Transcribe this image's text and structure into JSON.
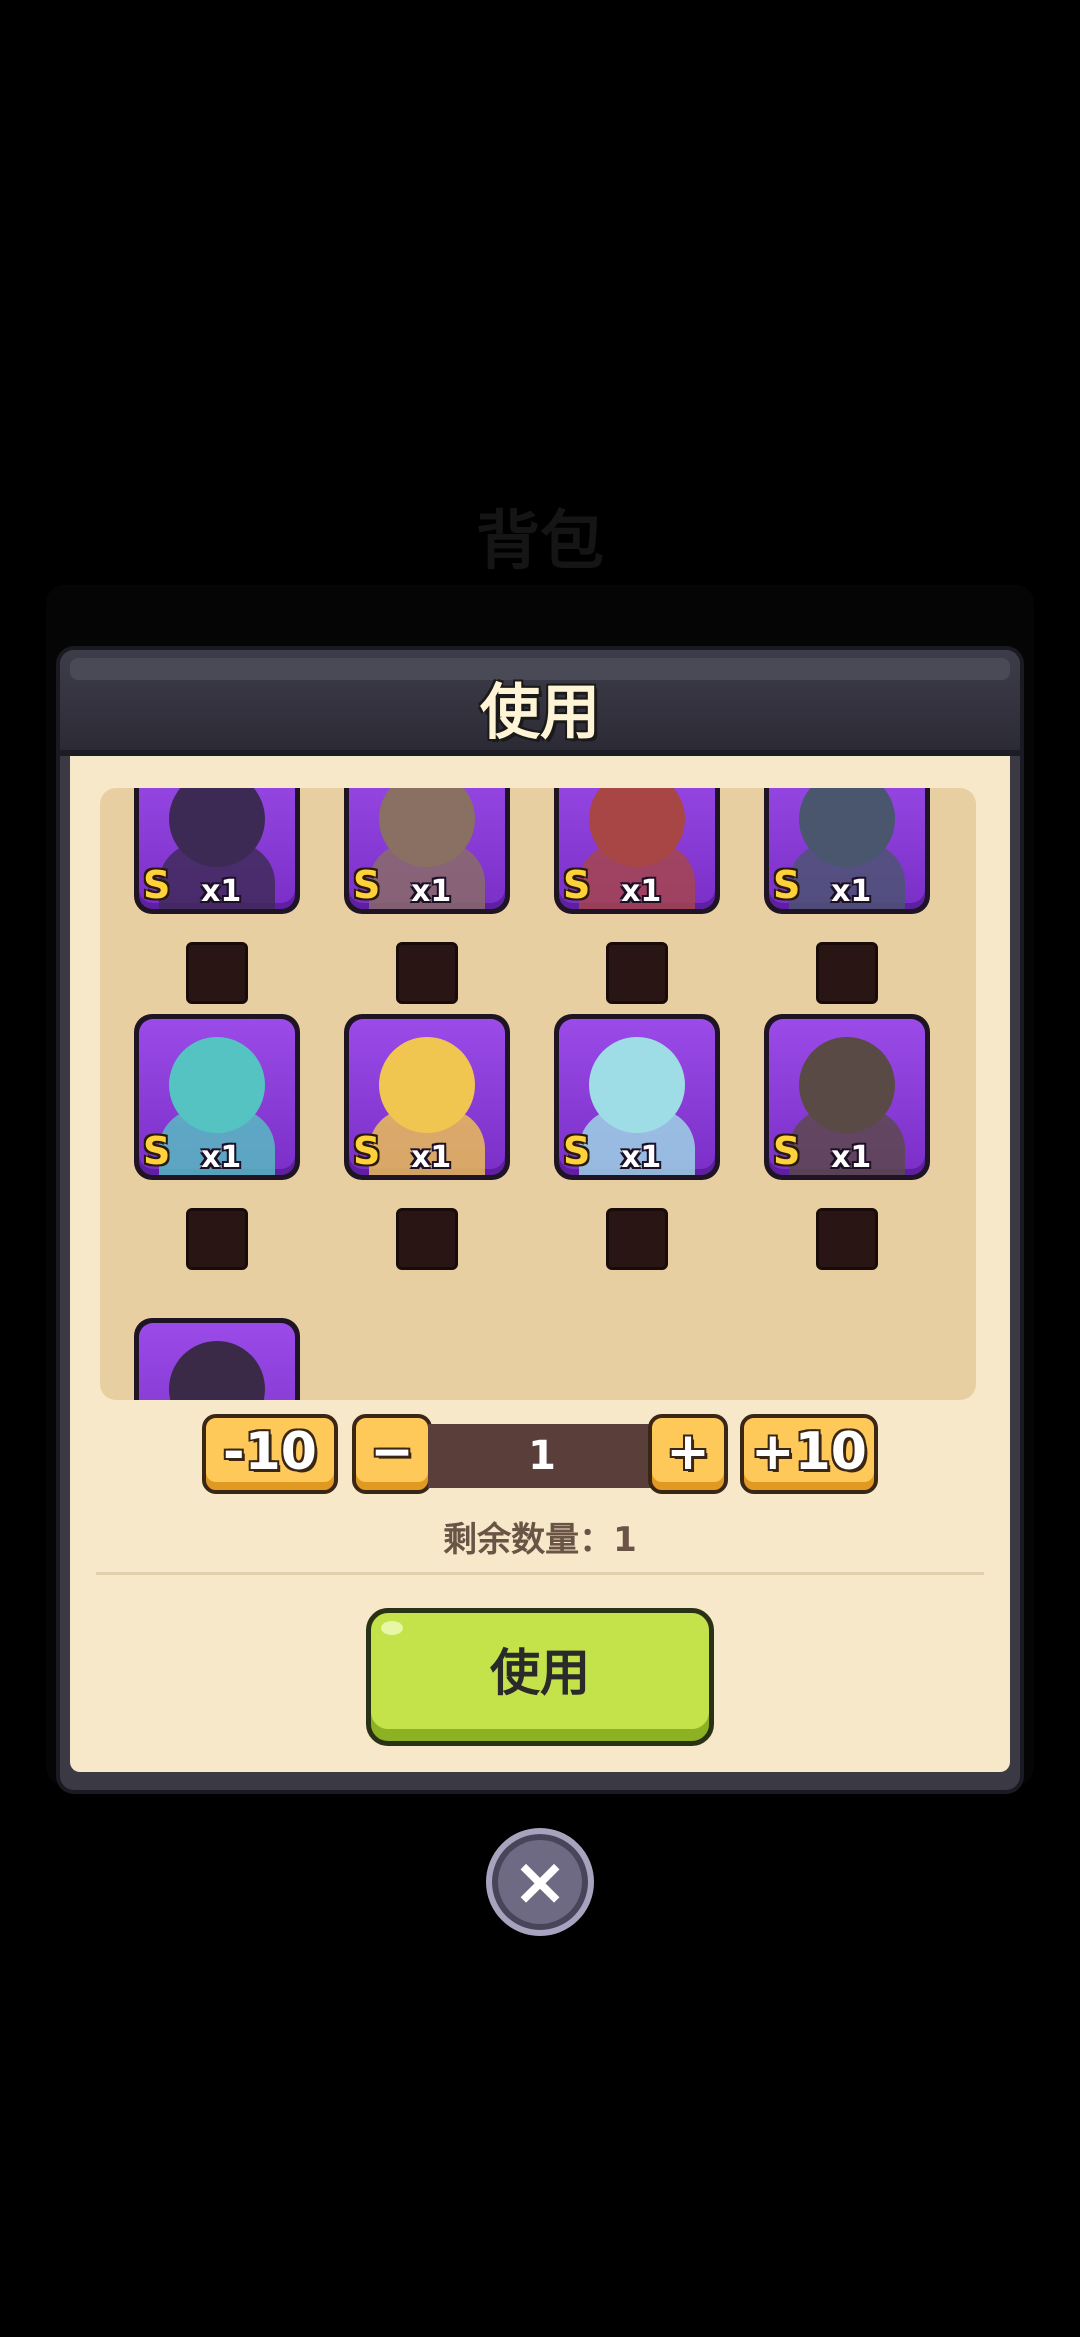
{
  "background_title": "背包",
  "modal": {
    "title": "使用"
  },
  "items": [
    {
      "rank": "S",
      "count": "x1",
      "color": "#3c2a54",
      "name": "shadow-flower"
    },
    {
      "rank": "S",
      "count": "x1",
      "color": "#8a6f63",
      "name": "knight"
    },
    {
      "rank": "S",
      "count": "x1",
      "color": "#a84646",
      "name": "red-beast"
    },
    {
      "rank": "S",
      "count": "x1",
      "color": "#4a566e",
      "name": "robot"
    },
    {
      "rank": "S",
      "count": "x1",
      "color": "#55c3c1",
      "name": "hooded-ghost"
    },
    {
      "rank": "S",
      "count": "x1",
      "color": "#f0c650",
      "name": "pharaoh"
    },
    {
      "rank": "S",
      "count": "x1",
      "color": "#9fdde6",
      "name": "ice-warrior"
    },
    {
      "rank": "S",
      "count": "x1",
      "color": "#5a4a45",
      "name": "stone-golem"
    },
    {
      "rank": "",
      "count": "",
      "color": "#3a2a48",
      "name": "dark-hero"
    }
  ],
  "stepper": {
    "minus10": "-10",
    "minus": "−",
    "value": "1",
    "plus": "+",
    "plus10": "+10"
  },
  "remaining_label": "剩余数量：1",
  "use_button": "使用",
  "close_icon": "×"
}
